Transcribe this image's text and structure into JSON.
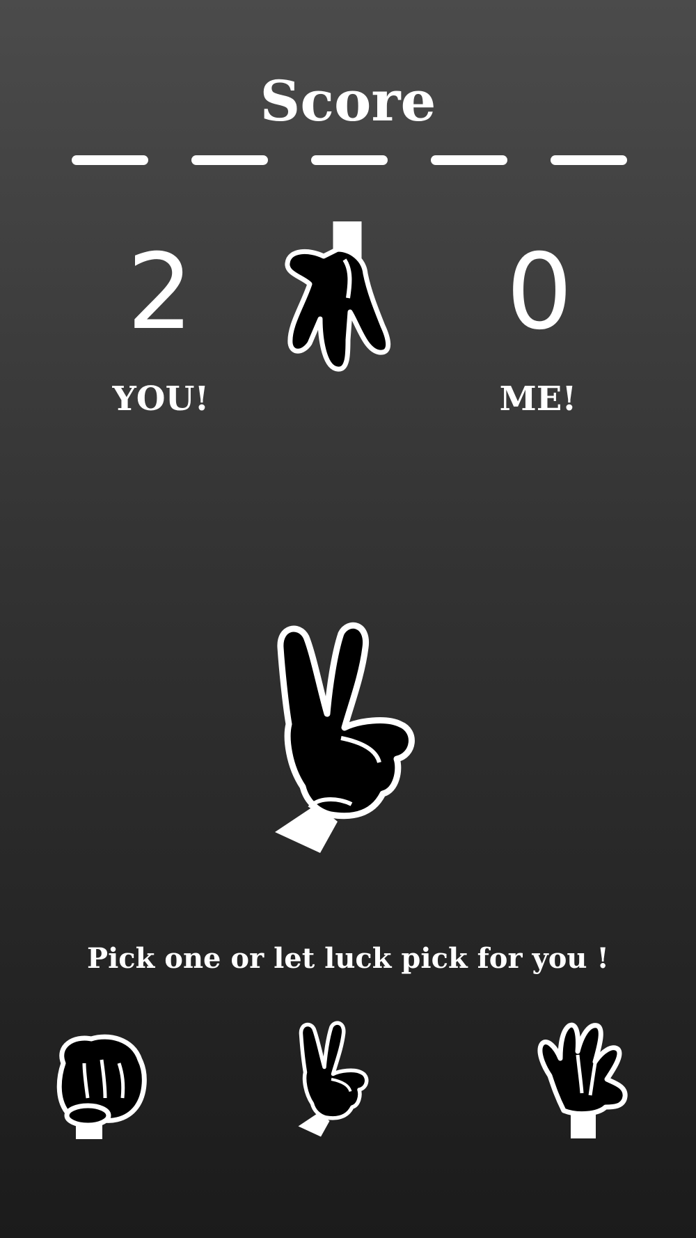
{
  "header": {
    "title": "Score"
  },
  "score": {
    "player": {
      "value": "2",
      "label": "YOU!"
    },
    "opponent": {
      "value": "0",
      "label": "ME!"
    }
  },
  "opponent_hand": {
    "icon": "paper-hand-icon"
  },
  "player_hand": {
    "icon": "scissors-hand-icon"
  },
  "prompt": "Pick one or let luck pick for you !",
  "choices": [
    {
      "name": "rock",
      "icon": "rock-fist-icon"
    },
    {
      "name": "scissors",
      "icon": "scissors-hand-icon"
    },
    {
      "name": "paper",
      "icon": "paper-hand-icon"
    }
  ],
  "colors": {
    "foreground": "#ffffff",
    "hand_fill": "#000000"
  }
}
